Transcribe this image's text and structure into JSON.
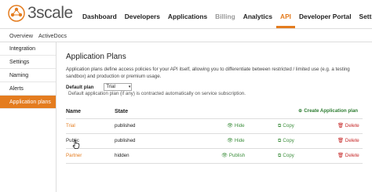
{
  "brand": {
    "name": "3scale",
    "accent": "#e47c1f"
  },
  "nav": {
    "items": [
      {
        "label": "Dashboard",
        "state": "normal"
      },
      {
        "label": "Developers",
        "state": "normal"
      },
      {
        "label": "Applications",
        "state": "normal"
      },
      {
        "label": "Billing",
        "state": "muted"
      },
      {
        "label": "Analytics",
        "state": "normal"
      },
      {
        "label": "API",
        "state": "active"
      },
      {
        "label": "Developer Portal",
        "state": "normal"
      },
      {
        "label": "Settings",
        "state": "normal"
      }
    ]
  },
  "subnav": {
    "items": [
      "Overview",
      "ActiveDocs"
    ]
  },
  "sidebar": {
    "items": [
      "Integration",
      "Settings",
      "Naming",
      "Alerts",
      "Application plans"
    ],
    "active_index": 4
  },
  "main": {
    "title": "Application Plans",
    "description": "Application plans define access policies for your API itself, allowing you to differentiate between restricted / limited use (e.g. a testing sandbox) and production or premium usage.",
    "default_plan_label": "Default plan",
    "default_plan_value": "Trial",
    "default_plan_hint": "Default application plan (if any) is contracted automatically on service subscription.",
    "create_label": "Create Application plan"
  },
  "table": {
    "headers": {
      "name": "Name",
      "state": "State"
    },
    "rows": [
      {
        "name": "Trial",
        "state": "published",
        "toggle": "Hide",
        "copy": "Copy",
        "delete": "Delete"
      },
      {
        "name": "Public",
        "state": "published",
        "toggle": "Hide",
        "copy": "Copy",
        "delete": "Delete"
      },
      {
        "name": "Partner",
        "state": "hidden",
        "toggle": "Publish",
        "copy": "Copy",
        "delete": "Delete"
      }
    ]
  },
  "icons": {
    "logo": "3scale-logo-icon",
    "create": "plus-circle-icon",
    "hide": "eye-icon",
    "copy": "copy-icon",
    "delete": "trash-icon",
    "cursor": "hand-pointer-icon"
  }
}
